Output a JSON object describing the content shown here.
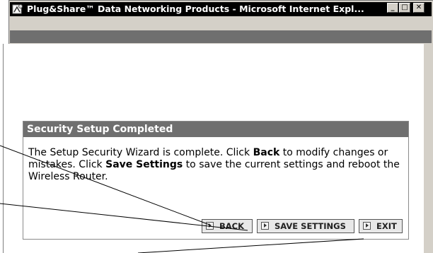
{
  "window": {
    "title": "Plug&Share™ Data Networking Products - Microsoft Internet Expl...",
    "minimize_glyph": "_",
    "maximize_glyph": "□",
    "close_glyph": "✕"
  },
  "panel": {
    "header": "Security Setup Completed",
    "body_part1": "The Setup Security Wizard is complete. Click ",
    "body_back_bold": "Back",
    "body_part2": " to modify changes or mistakes. Click ",
    "body_save_bold": "Save Settings",
    "body_part3": " to save the current settings and reboot the Wireless Router."
  },
  "buttons": {
    "back": "BACK",
    "save_settings": "SAVE SETTINGS",
    "exit": "EXIT"
  },
  "colors": {
    "titlebar": "#000000",
    "header_gray": "#6f6f6f",
    "window_gray": "#d4d0c8"
  }
}
